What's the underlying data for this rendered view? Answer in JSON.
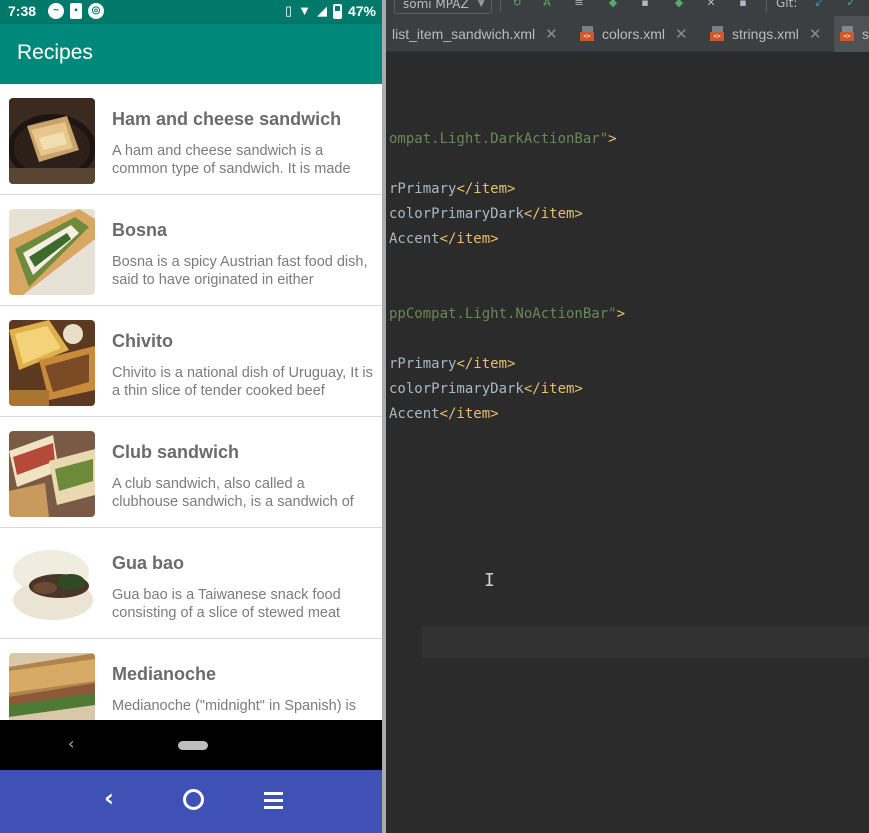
{
  "status_bar": {
    "time": "7:38",
    "battery": "47%"
  },
  "app_bar": {
    "title": "Recipes"
  },
  "recipes": [
    {
      "title": "Ham and cheese sandwich",
      "description": "A ham and cheese sandwich is a common type of sandwich. It is made"
    },
    {
      "title": "Bosna",
      "description": "Bosna is a spicy Austrian fast food dish, said to have originated in either"
    },
    {
      "title": "Chivito",
      "description": "Chivito is a national dish of Uruguay, It is a thin slice of tender cooked beef"
    },
    {
      "title": "Club sandwich",
      "description": "A club sandwich, also called a clubhouse sandwich, is a sandwich of"
    },
    {
      "title": "Gua bao",
      "description": "Gua bao is a Taiwanese snack food consisting of a slice of stewed meat"
    },
    {
      "title": "Medianoche",
      "description": "Medianoche (\"midnight\" in Spanish) is"
    }
  ],
  "ide": {
    "toolbar": {
      "device_label": "somi MPAZ",
      "git_label": "Git:"
    },
    "tabs": [
      {
        "label": "list_item_sandwich.xml"
      },
      {
        "label": "colors.xml"
      },
      {
        "label": "strings.xml"
      },
      {
        "label": "s"
      }
    ],
    "code": {
      "line1_str": "ompat.Light.DarkActionBar\"",
      "line1_tag": ">",
      "line2_txt": "rPrimary",
      "line2_tag": "</item>",
      "line3_txt": "colorPrimaryDark",
      "line3_tag": "</item>",
      "line4_txt": "Accent",
      "line4_tag": "</item>",
      "line5_str": "ppCompat.Light.NoActionBar\"",
      "line5_tag": ">",
      "line6_txt": "rPrimary",
      "line6_tag": "</item>",
      "line7_txt": "colorPrimaryDark",
      "line7_tag": "</item>",
      "line8_txt": "Accent",
      "line8_tag": "</item>"
    }
  },
  "colors": {
    "status_bar": "#00796b",
    "app_bar": "#00897b",
    "host_nav": "#3f51b5",
    "ide_background": "#2b2b2b",
    "xml_tag": "#e8bf6a",
    "xml_string": "#6a8759"
  },
  "icons": [
    "messenger-icon",
    "sim-icon",
    "data-saver-icon",
    "vibrate-icon",
    "wifi-icon",
    "signal-icon",
    "battery-icon",
    "back-icon",
    "home-icon",
    "menu-icon",
    "xml-file-icon",
    "close-icon",
    "text-cursor-icon"
  ]
}
